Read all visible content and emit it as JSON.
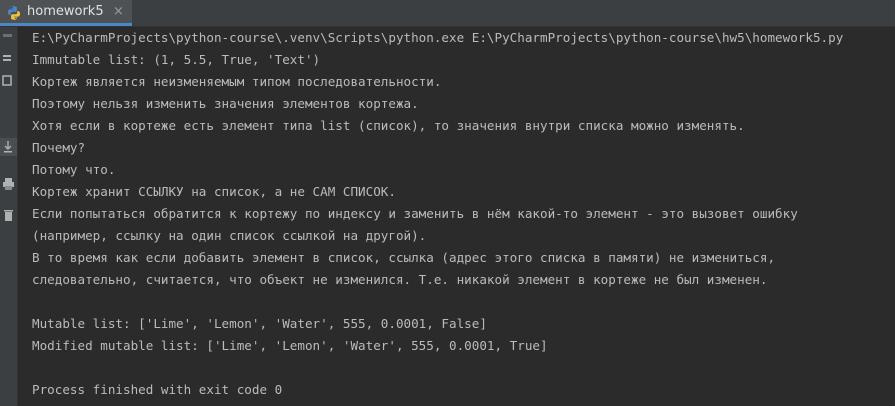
{
  "tab": {
    "label": "homework5",
    "close_glyph": "×",
    "icon": "python-file-icon"
  },
  "gutter": {
    "icons": [
      "rerun-icon",
      "stop-icon",
      "soft-wrap-icon",
      "scroll-to-end-icon",
      "print-icon",
      "delete-icon"
    ]
  },
  "console": {
    "lines": [
      "E:\\PyCharmProjects\\python-course\\.venv\\Scripts\\python.exe E:\\PyCharmProjects\\python-course\\hw5\\homework5.py",
      "Immutable list: (1, 5.5, True, 'Text')",
      "Кортеж является неизменяемым типом последовательности.",
      "Поэтому нельзя изменить значения элементов кортежа.",
      "Хотя если в кортеже есть элемент типа list (список), то значения внутри списка можно изменять.",
      "Почему?",
      "Потому что.",
      "Кортеж хранит ССЫЛКУ на список, а не САМ СПИСОК.",
      "Если попытаться обратится к кортежу по индексу и заменить в нём какой-то элемент - это вызовет ошибку",
      "(например, ссылку на один список ссылкой на другой).",
      "В то время как если добавить элемент в список, ссылка (адрес этого списка в памяти) не измениться,",
      "следовательно, считается, что объект не изменился. Т.е. никакой элемент в кортеже не был изменен.",
      "",
      "Mutable list: ['Lime', 'Lemon', 'Water', 555, 0.0001, False]",
      "Modified mutable list: ['Lime', 'Lemon', 'Water', 555, 0.0001, True]",
      "",
      "Process finished with exit code 0"
    ]
  },
  "colors": {
    "background": "#2b2b2b",
    "text": "#bbbbbb",
    "tab_underline": "#4a88c7"
  }
}
